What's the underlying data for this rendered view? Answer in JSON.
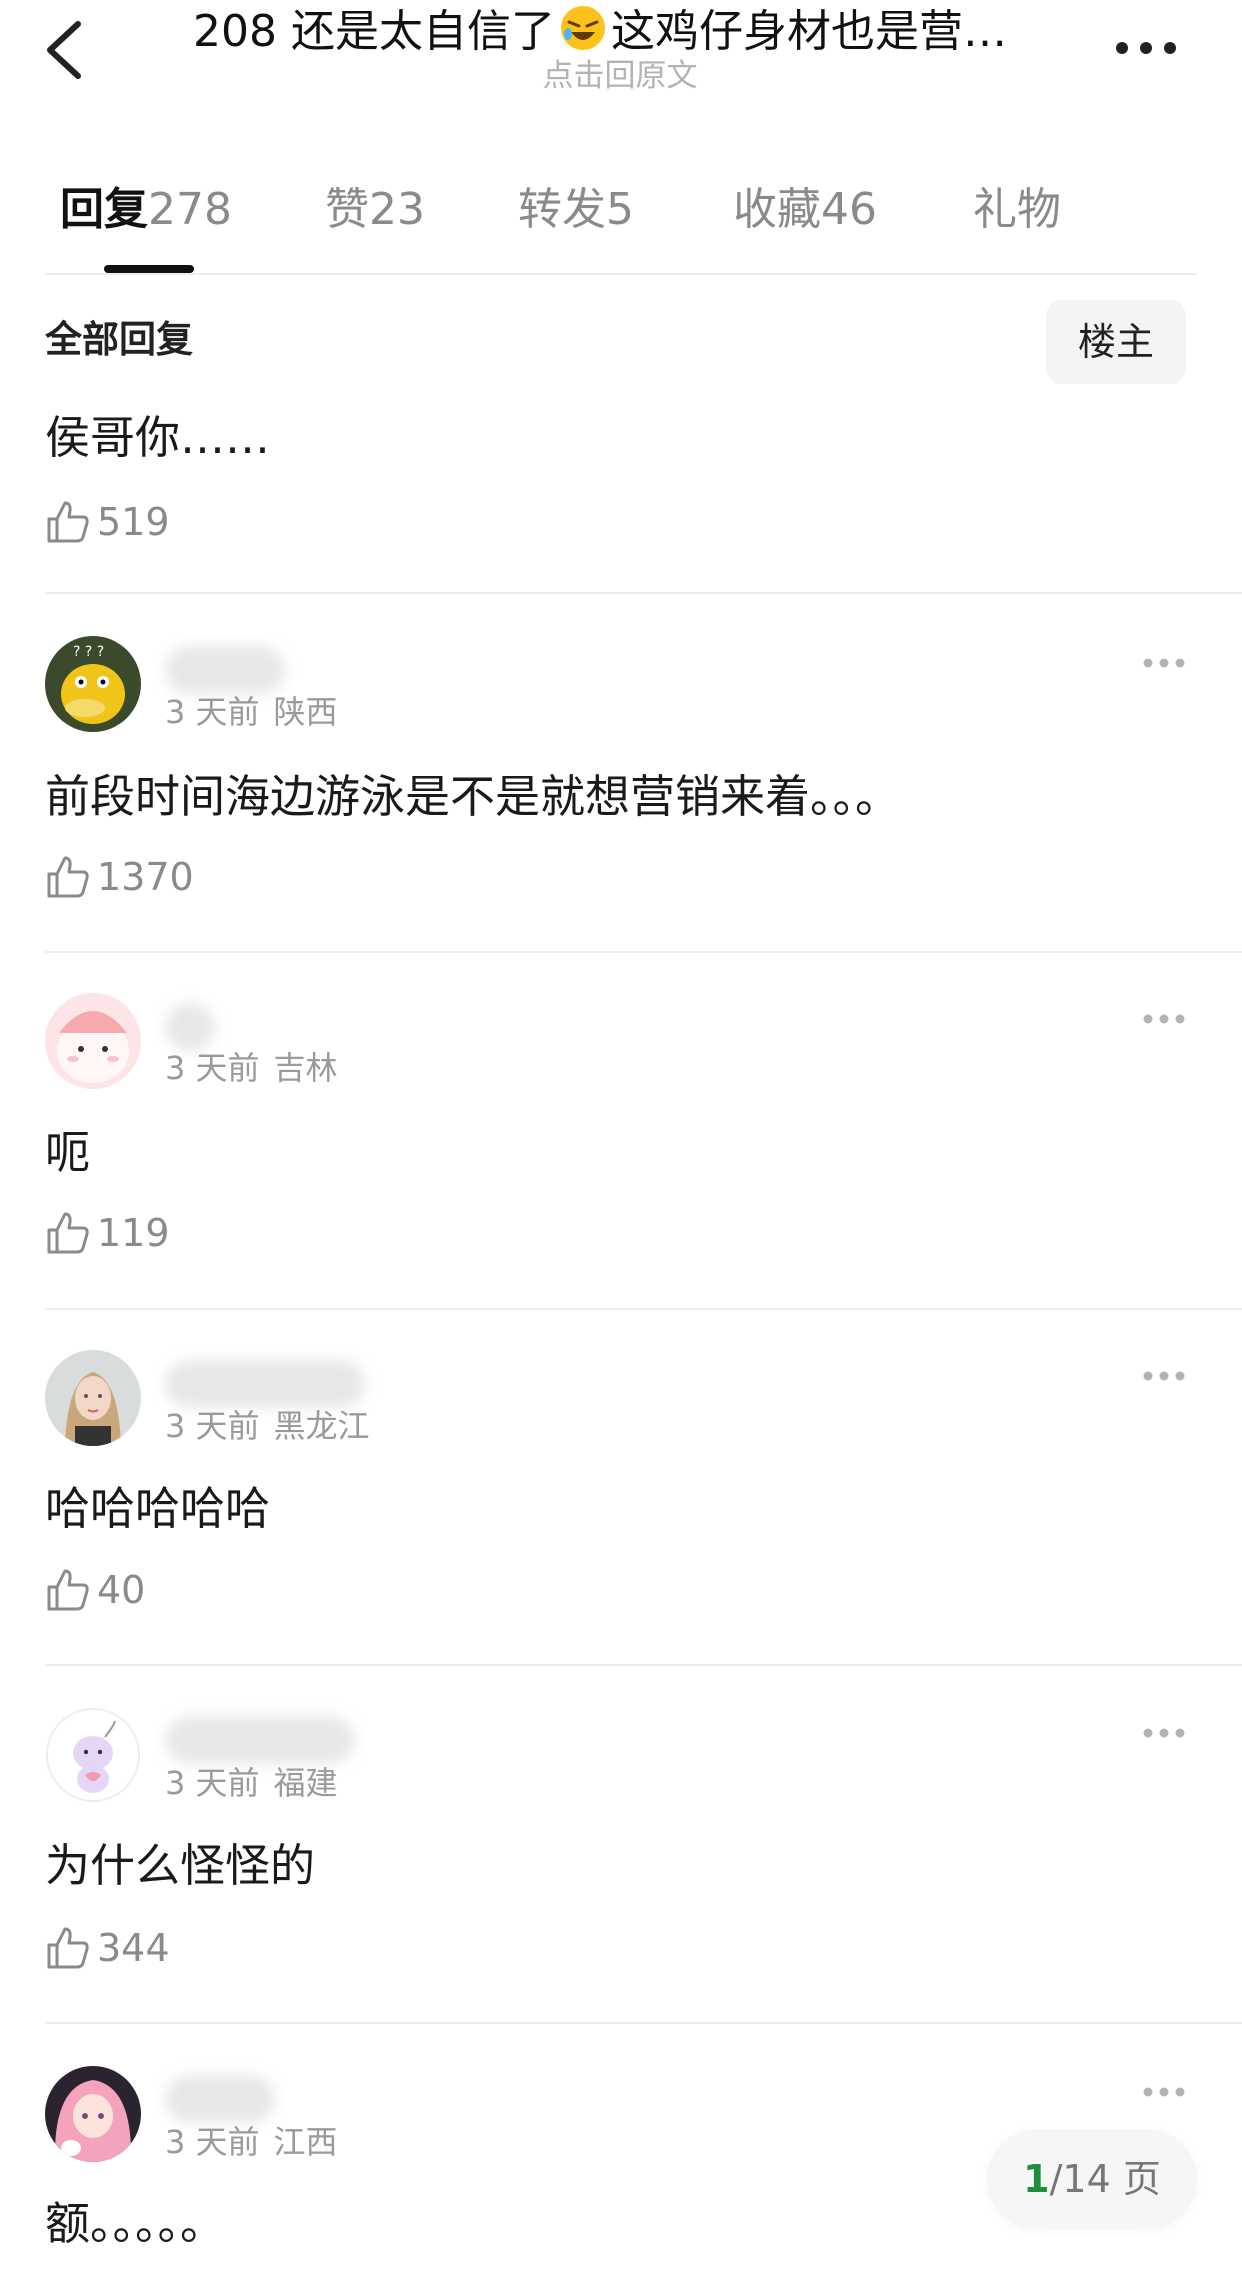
{
  "header": {
    "title_before": "208 还是太自信了",
    "title_emoji": "rolling-on-floor-laughing-emoji",
    "title_after": "这鸡仔身材也是营…",
    "subtitle": "点击回原文",
    "back_icon": "chevron-left-icon",
    "more_icon": "more-horizontal-icon"
  },
  "tabs": [
    {
      "name": "回复",
      "count": "278",
      "active": true
    },
    {
      "name": "赞",
      "count": "23",
      "active": false
    },
    {
      "name": "转发",
      "count": "5",
      "active": false
    },
    {
      "name": "收藏",
      "count": "46",
      "active": false
    },
    {
      "name": "礼物",
      "count": "",
      "active": false
    }
  ],
  "section": {
    "title": "全部回复",
    "owner_button": "楼主"
  },
  "comments": [
    {
      "text": "侯哥你……",
      "likes": "519"
    },
    {
      "time": "3 天前",
      "location": "陕西",
      "text": "前段时间海边游泳是不是就想营销来着。。。",
      "likes": "1370",
      "avatar": "yellow-duck-avatar"
    },
    {
      "time": "3 天前",
      "location": "吉林",
      "text": "呃",
      "likes": "119",
      "avatar": "pink-cartoon-avatar"
    },
    {
      "time": "3 天前",
      "location": "黑龙江",
      "text": "哈哈哈哈哈",
      "likes": "40",
      "avatar": "woman-portrait-avatar"
    },
    {
      "time": "3 天前",
      "location": "福建",
      "text": "为什么怪怪的",
      "likes": "344",
      "avatar": "purple-cartoon-avatar"
    },
    {
      "time": "3 天前",
      "location": "江西",
      "text": "额。。。。。",
      "avatar": "pink-hair-anime-avatar"
    }
  ],
  "pager": {
    "current": "1",
    "total": "/14 页"
  },
  "colors": {
    "accent_green": "#1e8e3e",
    "muted_text": "#9a9a9a",
    "divider": "#eeeeee"
  }
}
